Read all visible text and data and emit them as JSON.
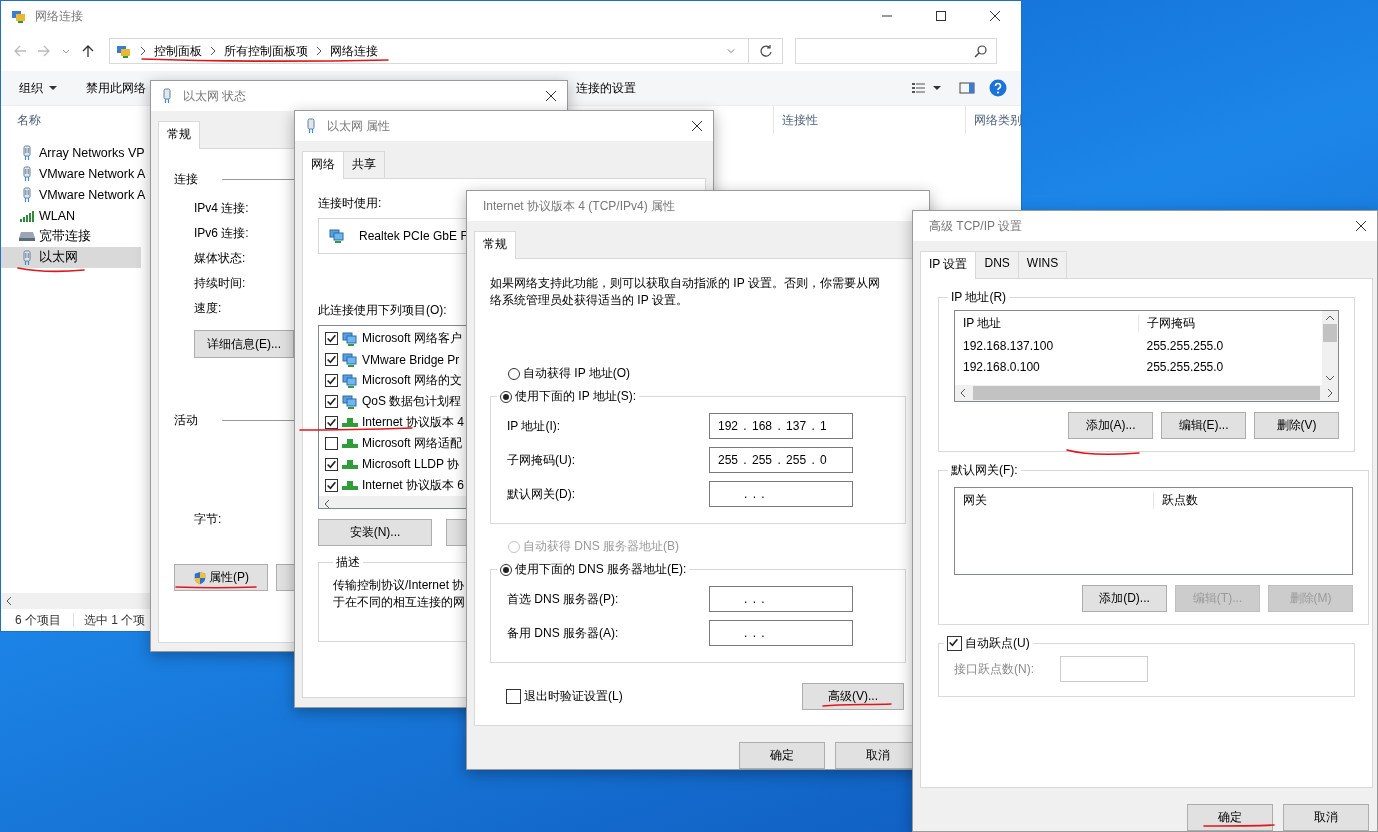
{
  "explorer": {
    "title": "网络连接",
    "breadcrumb": [
      "控制面板",
      "所有控制面板项",
      "网络连接"
    ],
    "toolbar": [
      "组织",
      "禁用此网络",
      "连接的设置"
    ],
    "columns": [
      "名称",
      "连接性",
      "网络类别"
    ],
    "items": [
      {
        "name": "Array Networks VP",
        "kind": "ethernet",
        "selected": false
      },
      {
        "name": "VMware Network A",
        "kind": "ethernet",
        "selected": false
      },
      {
        "name": "VMware Network A",
        "kind": "ethernet",
        "selected": false
      },
      {
        "name": "WLAN",
        "kind": "wifi",
        "selected": false
      },
      {
        "name": "宽带连接",
        "kind": "broadband",
        "selected": false
      },
      {
        "name": "以太网",
        "kind": "ethernet",
        "selected": true
      }
    ],
    "status_bar": [
      "6 个项目",
      "选中 1 个项"
    ]
  },
  "status_dialog": {
    "title": "以太网 状态",
    "tabs": [
      {
        "label": "常规",
        "selected": true
      }
    ],
    "connection_heading": "连接",
    "connection_fields": [
      "IPv4 连接:",
      "IPv6 连接:",
      "媒体状态:",
      "持续时间:",
      "速度:"
    ],
    "details_button": "详细信息(E)...",
    "activity_heading": "活动",
    "bytes_label": "字节:",
    "properties_button": "属性(P)"
  },
  "properties_dialog": {
    "title": "以太网 属性",
    "tabs": [
      {
        "label": "网络",
        "selected": true
      },
      {
        "label": "共享",
        "selected": false
      }
    ],
    "connect_using_label": "连接时使用:",
    "adapter": "Realtek PCIe GbE F",
    "items_label": "此连接使用下列项目(O):",
    "items": [
      {
        "name": "Microsoft 网络客户",
        "kind": "service",
        "checked": true
      },
      {
        "name": "VMware Bridge Pr",
        "kind": "service",
        "checked": true
      },
      {
        "name": "Microsoft 网络的文",
        "kind": "service",
        "checked": true
      },
      {
        "name": "QoS 数据包计划程",
        "kind": "service",
        "checked": true
      },
      {
        "name": "Internet 协议版本 4",
        "kind": "protocol",
        "checked": true
      },
      {
        "name": "Microsoft 网络适配",
        "kind": "protocol",
        "checked": false
      },
      {
        "name": "Microsoft LLDP 协",
        "kind": "protocol",
        "checked": true
      },
      {
        "name": "Internet 协议版本 6",
        "kind": "protocol",
        "checked": true
      }
    ],
    "install_button": "安装(N)...",
    "description_heading": "描述",
    "description": [
      "传输控制协议/Internet 协",
      "于在不同的相互连接的网"
    ]
  },
  "ipv4_dialog": {
    "title": "Internet 协议版本 4 (TCP/IPv4) 属性",
    "tabs": [
      {
        "label": "常规",
        "selected": true
      }
    ],
    "intro": "如果网络支持此功能，则可以获取自动指派的 IP 设置。否则，你需要从网络系统管理员处获得适当的 IP 设置。",
    "ip_options": [
      {
        "label": "自动获得 IP 地址(O)",
        "selected": false,
        "disabled": false
      },
      {
        "label": "使用下面的 IP 地址(S):",
        "selected": true,
        "disabled": false
      }
    ],
    "ip_fields": [
      {
        "label": "IP 地址(I):",
        "value": "192 . 168 . 137 . 1"
      },
      {
        "label": "子网掩码(U):",
        "value": "255 . 255 . 255 . 0"
      },
      {
        "label": "默认网关(D):",
        "value": ". . ."
      }
    ],
    "dns_options": [
      {
        "label": "自动获得 DNS 服务器地址(B)",
        "selected": false,
        "disabled": true
      },
      {
        "label": "使用下面的 DNS 服务器地址(E):",
        "selected": true,
        "disabled": false
      }
    ],
    "dns_fields": [
      {
        "label": "首选 DNS 服务器(P):",
        "value": ". . ."
      },
      {
        "label": "备用 DNS 服务器(A):",
        "value": ". . ."
      }
    ],
    "validate_on_exit": {
      "label": "退出时验证设置(L)",
      "checked": false
    },
    "advanced_button": "高级(V)...",
    "buttons": [
      "确定",
      "取消"
    ]
  },
  "advanced_dialog": {
    "title": "高级 TCP/IP 设置",
    "tabs": [
      {
        "label": "IP 设置",
        "selected": true
      },
      {
        "label": "DNS",
        "selected": false
      },
      {
        "label": "WINS",
        "selected": false
      }
    ],
    "ip_group": {
      "title": "IP 地址(R)",
      "columns": [
        "IP 地址",
        "子网掩码"
      ],
      "rows": [
        [
          "192.168.137.100",
          "255.255.255.0"
        ],
        [
          "192.168.0.100",
          "255.255.255.0"
        ]
      ],
      "buttons": [
        {
          "label": "添加(A)...",
          "disabled": false
        },
        {
          "label": "编辑(E)...",
          "disabled": false
        },
        {
          "label": "删除(V)",
          "disabled": false
        }
      ]
    },
    "gateway_group": {
      "title": "默认网关(F):",
      "columns": [
        "网关",
        "跃点数"
      ],
      "buttons": [
        {
          "label": "添加(D)...",
          "disabled": false
        },
        {
          "label": "编辑(T)...",
          "disabled": true
        },
        {
          "label": "删除(M)",
          "disabled": true
        }
      ]
    },
    "auto_metric": {
      "label": "自动跃点(U)",
      "checked": true
    },
    "metric_label": "接口跃点数(N):",
    "buttons": [
      "确定",
      "取消"
    ]
  }
}
